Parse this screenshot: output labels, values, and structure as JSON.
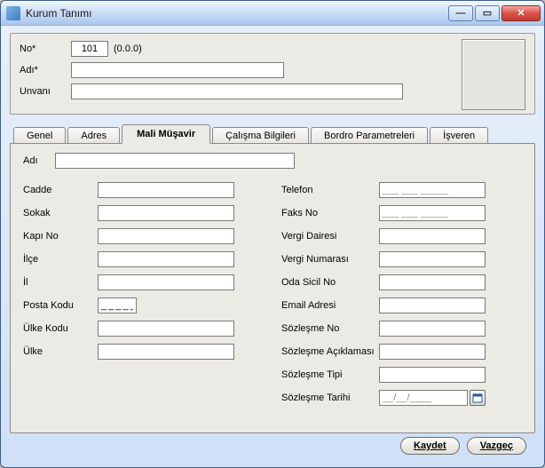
{
  "window": {
    "title": "Kurum Tanımı"
  },
  "header": {
    "no_label": "No*",
    "no_value": "101",
    "no_suffix": "(0.0.0)",
    "adi_label": "Adı*",
    "adi_value": "",
    "unvani_label": "Unvanı",
    "unvani_value": ""
  },
  "tabs": {
    "genel": "Genel",
    "adres": "Adres",
    "mali": "Mali Müşavir",
    "calisma": "Çalışma Bilgileri",
    "bordro": "Bordro Parametreleri",
    "isveren": "İşveren"
  },
  "mali": {
    "adi_label": "Adı",
    "adi_value": "",
    "left": {
      "cadde_label": "Cadde",
      "cadde_value": "",
      "sokak_label": "Sokak",
      "sokak_value": "",
      "kapino_label": "Kapı No",
      "kapino_value": "",
      "ilce_label": "İlçe",
      "ilce_value": "",
      "il_label": "İl",
      "il_value": "",
      "postakodu_label": "Posta Kodu",
      "postakodu_value": "_____",
      "ulkekodu_label": "Ülke Kodu",
      "ulkekodu_value": "",
      "ulke_label": "Ülke",
      "ulke_value": ""
    },
    "right": {
      "telefon_label": "Telefon",
      "telefon_value": "___ ___ _____",
      "faks_label": "Faks No",
      "faks_value": "___ ___ _____",
      "vergidairesi_label": "Vergi Dairesi",
      "vergidairesi_value": "",
      "verginumarasi_label": "Vergi Numarası",
      "verginumarasi_value": "",
      "odasicil_label": "Oda Sicil No",
      "odasicil_value": "",
      "email_label": "Email Adresi",
      "email_value": "",
      "sozlesmeno_label": "Sözleşme No",
      "sozlesmeno_value": "",
      "sozlesmeacik_label": "Sözleşme Açıklaması",
      "sozlesmeacik_value": "",
      "sozlesmetipi_label": "Sözleşme Tipi",
      "sozlesmetipi_value": "",
      "sozlesmetarihi_label": "Sözleşme Tarihi",
      "sozlesmetarihi_value": "__/__/____"
    }
  },
  "buttons": {
    "save": "Kaydet",
    "cancel": "Vazgeç"
  }
}
